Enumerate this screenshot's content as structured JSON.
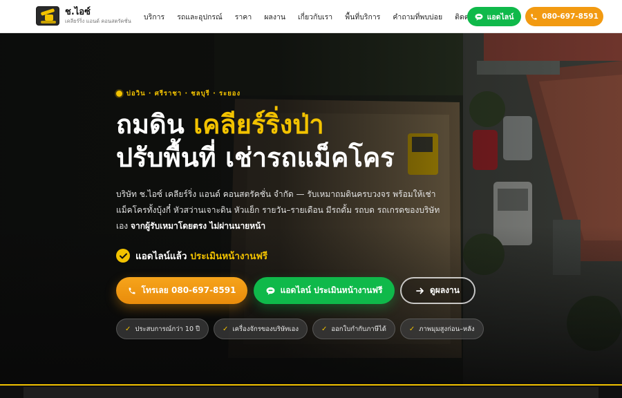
{
  "header": {
    "brand_name": "ช.ไอซ์",
    "brand_sub": "เคลียร์ริ่ง แอนด์ คอนสตรัคชั่น",
    "nav": [
      "บริการ",
      "รถและอุปกรณ์",
      "ราคา",
      "ผลงาน",
      "เกี่ยวกับเรา",
      "พื้นที่บริการ",
      "คำถามที่พบบ่อย",
      "ติดต่อ"
    ],
    "line_button": "แอดไลน์",
    "phone_button": "080-697-8591"
  },
  "hero": {
    "eyebrow": "บ่อวิน · ศรีราชา · ชลบุรี · ระยอง",
    "title_line1_plain": "ถมดิน ",
    "title_line1_highlight": "เคลียร์ริ่งป่า",
    "title_line2": "ปรับพื้นที่ เช่ารถแม็คโคร",
    "lead_text": "บริษัท ช.ไอซ์ เคลียร์ริ่ง แอนด์ คอนสตรัคชั่น จำกัด — รับเหมาถมดินครบวงจร พร้อมให้เช่าแม็คโครทั้งบุ้งกี๋ หัวสว่านเจาะดิน หัวแย็ก รายวัน–รายเดือน มีรถดั้ม รถบด รถเกรดของบริษัทเอง ",
    "lead_bold": "จากผู้รับเหมาโดยตรง ไม่ผ่านนายหน้า",
    "check_plain": "แอดไลน์แล้ว",
    "check_highlight": "ประเมินหน้างานฟรี",
    "cta_phone": "โทรเลย 080-697-8591",
    "cta_line": "แอดไลน์ ประเมินหน้างานฟรี",
    "cta_works": "ดูผลงาน",
    "chips": [
      "ประสบการณ์กว่า 10 ปี",
      "เครื่องจักรของบริษัทเอง",
      "ออกใบกำกับภาษีได้",
      "ภาพมุมสูงก่อน–หลัง"
    ]
  },
  "colors": {
    "accent": "#f2c200",
    "line_green": "#0fb94a",
    "phone_orange": "#f29a11"
  },
  "icons": [
    "excavator-logo-icon",
    "line-chat-icon",
    "phone-icon",
    "check-icon",
    "arrow-right-icon"
  ]
}
